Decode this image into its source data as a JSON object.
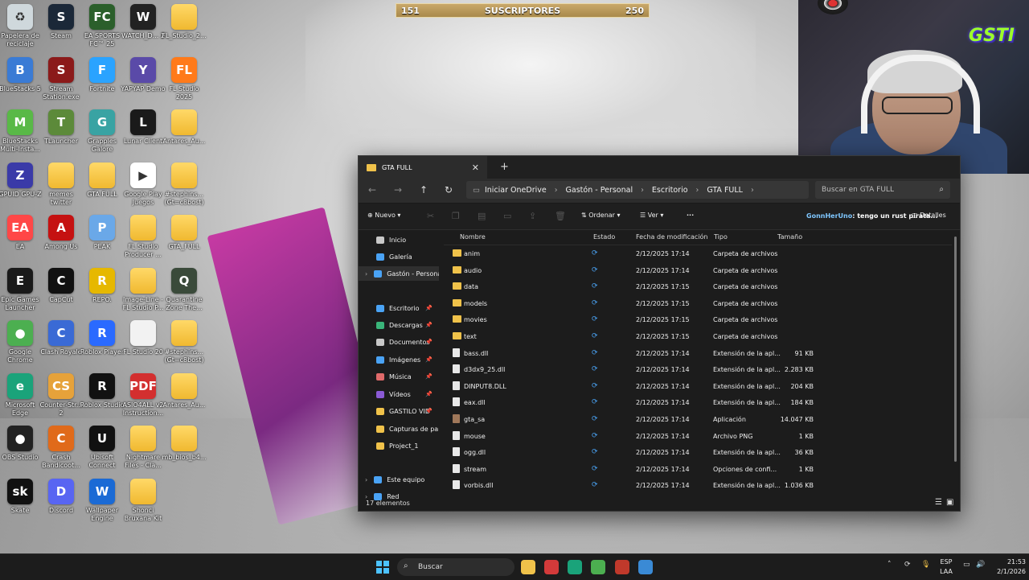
{
  "subscribers": {
    "left_value": "151",
    "label": "SUSCRIPTORES",
    "right_value": "250"
  },
  "desktop_icons": [
    {
      "label": "Papelera de reciclaje",
      "color": "#cfd8dc",
      "glyph": "♻"
    },
    {
      "label": "Steam",
      "color": "#1b2838",
      "glyph": "S"
    },
    {
      "label": "EA SPORTS FC™ 25",
      "color": "#2b5f2b",
      "glyph": "FC"
    },
    {
      "label": "WATCH_D... 2",
      "color": "#222222",
      "glyph": "W"
    },
    {
      "label": "FL_Studio_2...",
      "color": "#f0b930",
      "glyph": ""
    },
    {
      "label": "BlueStacks 5",
      "color": "#3a7bd5",
      "glyph": "B"
    },
    {
      "label": "Stream Station.exe",
      "color": "#8b1a1a",
      "glyph": "S"
    },
    {
      "label": "Fortnite",
      "color": "#2aa3ff",
      "glyph": "F"
    },
    {
      "label": "YAPYAP Demo",
      "color": "#5a4aa8",
      "glyph": "Y"
    },
    {
      "label": "FL Studio 2025",
      "color": "#ff7a1a",
      "glyph": "FL"
    },
    {
      "label": "BlueStacks Multi-Insta...",
      "color": "#59b947",
      "glyph": "M"
    },
    {
      "label": "TLauncher",
      "color": "#5c8a3a",
      "glyph": "T"
    },
    {
      "label": "Grapples Galore",
      "color": "#39a3a3",
      "glyph": "G"
    },
    {
      "label": "Lunar Client",
      "color": "#1a1a1a",
      "glyph": "L"
    },
    {
      "label": "Antares_Au...",
      "color": "#f0b930",
      "glyph": ""
    },
    {
      "label": "GPUID GPU-Z",
      "color": "#3a3aa8",
      "glyph": "Z"
    },
    {
      "label": "memes twitter",
      "color": "#f0b930",
      "glyph": ""
    },
    {
      "label": "GTA FULL",
      "color": "#f0b930",
      "glyph": ""
    },
    {
      "label": "Google Play Juegos",
      "color": "#ffffff",
      "glyph": "▶"
    },
    {
      "label": "#stephins... (Gt=c8bost)",
      "color": "#f0b930",
      "glyph": ""
    },
    {
      "label": "EA",
      "color": "#ff4747",
      "glyph": "EA"
    },
    {
      "label": "Among Us",
      "color": "#c51111",
      "glyph": "A"
    },
    {
      "label": "PEAK",
      "color": "#6aa8e8",
      "glyph": "P"
    },
    {
      "label": "FL Studio Producer ...",
      "color": "#f0b930",
      "glyph": ""
    },
    {
      "label": "GTA_FULL",
      "color": "#f0b930",
      "glyph": ""
    },
    {
      "label": "Epic Games Launcher",
      "color": "#1a1a1a",
      "glyph": "E"
    },
    {
      "label": "CapCut",
      "color": "#111111",
      "glyph": "C"
    },
    {
      "label": "REPO.",
      "color": "#e6b800",
      "glyph": "R"
    },
    {
      "label": "Image-Line - FL Studio P...",
      "color": "#f0b930",
      "glyph": ""
    },
    {
      "label": "Quarantine Zone The...",
      "color": "#3a4a3a",
      "glyph": "Q"
    },
    {
      "label": "Google Chrome",
      "color": "#4caf50",
      "glyph": "●"
    },
    {
      "label": "Clash Royale",
      "color": "#3a6ad5",
      "glyph": "C"
    },
    {
      "label": "Roblox Player",
      "color": "#2a6aff",
      "glyph": "R"
    },
    {
      "label": "FL Studio 20",
      "color": "#f2f2f2",
      "glyph": ""
    },
    {
      "label": "#stephins... (Gt=c8bost)",
      "color": "#f0b930",
      "glyph": ""
    },
    {
      "label": "Microsoft Edge",
      "color": "#1aa37a",
      "glyph": "e"
    },
    {
      "label": "Counter-Str... 2",
      "color": "#e6a23a",
      "glyph": "CS"
    },
    {
      "label": "Roblox Studio",
      "color": "#111111",
      "glyph": "R"
    },
    {
      "label": "ASIO4ALL v2 Instruction...",
      "color": "#d32f2f",
      "glyph": "PDF"
    },
    {
      "label": "Antares_Au...",
      "color": "#f0b930",
      "glyph": ""
    },
    {
      "label": "OBS Studio",
      "color": "#222222",
      "glyph": "●"
    },
    {
      "label": "Crash Bandicoot...",
      "color": "#e06a1a",
      "glyph": "C"
    },
    {
      "label": "Ubisoft Connect",
      "color": "#111111",
      "glyph": "U"
    },
    {
      "label": "Nightmare Files - Cla...",
      "color": "#f0b930",
      "glyph": ""
    },
    {
      "label": "mb_bios_b4...",
      "color": "#f0b930",
      "glyph": ""
    },
    {
      "label": "Skate",
      "color": "#111111",
      "glyph": "sk"
    },
    {
      "label": "Discord",
      "color": "#5865f2",
      "glyph": "D"
    },
    {
      "label": "Wallpaper Engine",
      "color": "#1a6ad5",
      "glyph": "W"
    },
    {
      "label": "Shonci Bruxana Kit",
      "color": "#f0b930",
      "glyph": ""
    }
  ],
  "webcam": {
    "logo": "GSTI"
  },
  "explorer": {
    "tab_title": "GTA FULL",
    "tab_close": "✕",
    "new_tab": "+",
    "breadcrumb": [
      "Iniciar OneDrive",
      "Gastón - Personal",
      "Escritorio",
      "GTA FULL"
    ],
    "search_placeholder": "Buscar en GTA FULL",
    "toolbar": {
      "new_label": "Nuevo",
      "sort_label": "Ordenar",
      "view_label": "Ver",
      "more_label": "···",
      "details_label": "Detalles"
    },
    "chat_overlay": {
      "user": "GonnHerUno",
      "message": ": tengo un rust pirata..."
    },
    "nav_pane": [
      {
        "label": "Inicio",
        "color": "#c8c8c8",
        "pinned": false
      },
      {
        "label": "Galería",
        "color": "#4aa3f5",
        "pinned": false
      },
      {
        "label": "Gastón - Personal",
        "color": "#4aa3f5",
        "pinned": false
      },
      {
        "label": "Escritorio",
        "color": "#4aa3f5",
        "pinned": true
      },
      {
        "label": "Descargas",
        "color": "#3ab57a",
        "pinned": true
      },
      {
        "label": "Documentos",
        "color": "#c8c8c8",
        "pinned": true
      },
      {
        "label": "Imágenes",
        "color": "#4aa3f5",
        "pinned": true
      },
      {
        "label": "Música",
        "color": "#e06a6a",
        "pinned": true
      },
      {
        "label": "Vídeos",
        "color": "#8a5ad5",
        "pinned": true
      },
      {
        "label": "GASTILO VID",
        "color": "#f0c24a",
        "pinned": true
      },
      {
        "label": "Capturas de par",
        "color": "#f0c24a",
        "pinned": false
      },
      {
        "label": "Project_1",
        "color": "#f0c24a",
        "pinned": false
      },
      {
        "label": "Este equipo",
        "color": "#4aa3f5",
        "pinned": false
      },
      {
        "label": "Red",
        "color": "#4aa3f5",
        "pinned": false
      }
    ],
    "columns": {
      "name": "Nombre",
      "status": "Estado",
      "modified": "Fecha de modificación",
      "type": "Tipo",
      "size": "Tamaño"
    },
    "files": [
      {
        "name": "anim",
        "modified": "2/12/2025 17:14",
        "type": "Carpeta de archivos",
        "size": "",
        "kind": "folder"
      },
      {
        "name": "audio",
        "modified": "2/12/2025 17:14",
        "type": "Carpeta de archivos",
        "size": "",
        "kind": "folder"
      },
      {
        "name": "data",
        "modified": "2/12/2025 17:15",
        "type": "Carpeta de archivos",
        "size": "",
        "kind": "folder"
      },
      {
        "name": "models",
        "modified": "2/12/2025 17:15",
        "type": "Carpeta de archivos",
        "size": "",
        "kind": "folder"
      },
      {
        "name": "movies",
        "modified": "2/12/2025 17:15",
        "type": "Carpeta de archivos",
        "size": "",
        "kind": "folder"
      },
      {
        "name": "text",
        "modified": "2/12/2025 17:15",
        "type": "Carpeta de archivos",
        "size": "",
        "kind": "folder"
      },
      {
        "name": "bass.dll",
        "modified": "2/12/2025 17:14",
        "type": "Extensión de la apl...",
        "size": "91 KB",
        "kind": "file"
      },
      {
        "name": "d3dx9_25.dll",
        "modified": "2/12/2025 17:14",
        "type": "Extensión de la apl...",
        "size": "2.283 KB",
        "kind": "file"
      },
      {
        "name": "DINPUT8.DLL",
        "modified": "2/12/2025 17:14",
        "type": "Extensión de la apl...",
        "size": "204 KB",
        "kind": "file"
      },
      {
        "name": "eax.dll",
        "modified": "2/12/2025 17:14",
        "type": "Extensión de la apl...",
        "size": "184 KB",
        "kind": "file"
      },
      {
        "name": "gta_sa",
        "modified": "2/12/2025 17:14",
        "type": "Aplicación",
        "size": "14.047 KB",
        "kind": "app"
      },
      {
        "name": "mouse",
        "modified": "2/12/2025 17:14",
        "type": "Archivo PNG",
        "size": "1 KB",
        "kind": "file"
      },
      {
        "name": "ogg.dll",
        "modified": "2/12/2025 17:14",
        "type": "Extensión de la apl...",
        "size": "36 KB",
        "kind": "file"
      },
      {
        "name": "stream",
        "modified": "2/12/2025 17:14",
        "type": "Opciones de confi...",
        "size": "1 KB",
        "kind": "file"
      },
      {
        "name": "vorbis.dll",
        "modified": "2/12/2025 17:14",
        "type": "Extensión de la apl...",
        "size": "1.036 KB",
        "kind": "file"
      }
    ],
    "status_text": "17 elementos"
  },
  "taskbar": {
    "search_placeholder": "Buscar",
    "apps": [
      {
        "name": "explorer",
        "color": "#f0c24a"
      },
      {
        "name": "steam-like",
        "color": "#d33a3a"
      },
      {
        "name": "edge",
        "color": "#1aa37a"
      },
      {
        "name": "chrome",
        "color": "#4caf50"
      },
      {
        "name": "stream-app",
        "color": "#c0392b"
      },
      {
        "name": "window-app",
        "color": "#3a8ad5"
      }
    ],
    "lang_top": "ESP",
    "lang_bottom": "LAA",
    "time": "21:53",
    "date": "2/1/2026"
  }
}
